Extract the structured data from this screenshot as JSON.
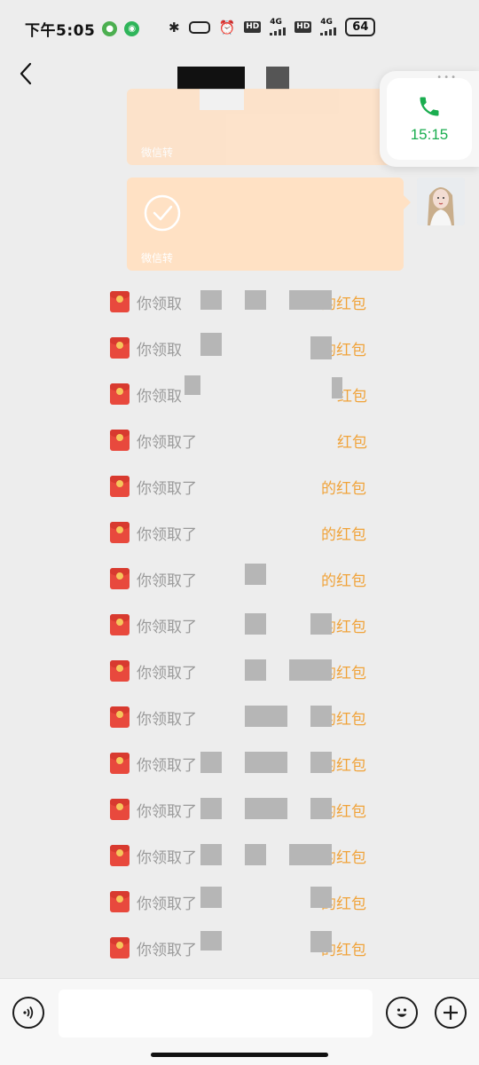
{
  "status_bar": {
    "time": "下午5:05",
    "network_1": "4G",
    "hd_1": "HD",
    "hd_2": "HD",
    "network_2": "4G",
    "battery": "64"
  },
  "header": {
    "back_icon": "chevron-left-icon"
  },
  "call_window": {
    "icon": "phone-icon",
    "duration": "15:15",
    "accent": "#1aad4f"
  },
  "transfers": [
    {
      "note": "微信转"
    },
    {
      "note": "微信转"
    }
  ],
  "red_packets": [
    {
      "prefix": "你领取",
      "suffix": "的红包"
    },
    {
      "prefix": "你领取",
      "suffix": "的红包"
    },
    {
      "prefix": "你领取",
      "suffix": "红包"
    },
    {
      "prefix": "你领取了",
      "suffix": "红包"
    },
    {
      "prefix": "你领取了",
      "suffix": "的红包"
    },
    {
      "prefix": "你领取了",
      "suffix": "的红包"
    },
    {
      "prefix": "你领取了",
      "suffix": "的红包"
    },
    {
      "prefix": "你领取了",
      "suffix": "的红包"
    },
    {
      "prefix": "你领取了",
      "suffix": "的红包"
    },
    {
      "prefix": "你领取了",
      "suffix": "的红包"
    },
    {
      "prefix": "你领取了",
      "suffix": "的红包"
    },
    {
      "prefix": "你领取了",
      "suffix": "的红包"
    },
    {
      "prefix": "你领取了",
      "suffix": "的红包"
    },
    {
      "prefix": "你领取了",
      "suffix": "的红包"
    },
    {
      "prefix": "你领取了",
      "suffix": "的红包"
    }
  ],
  "input_bar": {
    "voice_icon": "voice-icon",
    "emoji_icon": "emoji-icon",
    "plus_icon": "plus-icon",
    "input_value": ""
  },
  "colors": {
    "red_packet_link": "#f0a33a",
    "transfer_bubble": "#ffe1c4",
    "background": "#ededed"
  }
}
